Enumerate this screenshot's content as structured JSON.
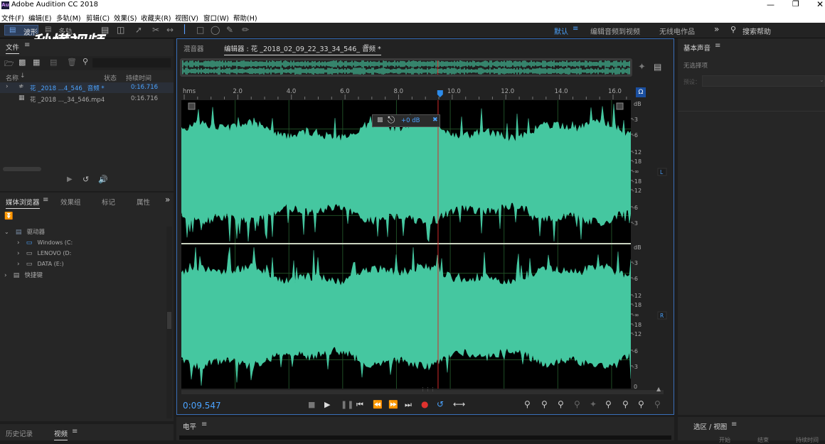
{
  "app": {
    "title": "Adobe Audition CC 2018",
    "logo": "Au"
  },
  "menu": [
    "文件(F)",
    "编辑(E)",
    "多轨(M)",
    "剪辑(C)",
    "效果(S)",
    "收藏夹(R)",
    "视图(V)",
    "窗口(W)",
    "帮助(H)"
  ],
  "toolbar": {
    "mode_waveform": "波形",
    "mode_multitrack": "多轨",
    "workspaces": [
      "默认",
      "编辑音频到视频",
      "无线电作品"
    ],
    "search_placeholder": "搜索帮助",
    "watermark": "秒懂视频"
  },
  "files_panel": {
    "tab": "文件",
    "columns": {
      "name": "名称",
      "status": "状态",
      "duration": "持续时间"
    },
    "rows": [
      {
        "name": "花 _2018 ...4_546_ 音频 *",
        "duration": "0:16.716",
        "selected": true
      },
      {
        "name": "花 _2018 ..._34_546.mp4",
        "duration": "0:16.716",
        "selected": false
      }
    ]
  },
  "media_panel": {
    "tabs": [
      "媒体浏览器",
      "效果组",
      "标记",
      "属性"
    ],
    "tree": [
      {
        "label": "驱动器",
        "level": 0
      },
      {
        "label": "Windows (C:",
        "level": 1
      },
      {
        "label": "LENOVO (D:",
        "level": 1
      },
      {
        "label": "DATA (E:)",
        "level": 1
      },
      {
        "label": "快捷键",
        "level": 0
      }
    ]
  },
  "bottom_left_tabs": [
    "历史记录",
    "视频"
  ],
  "editor": {
    "tab_mixer": "混音器",
    "tab_editor": "编辑器 : 花 _2018_02_09_22_33_34_546_ 音频 *",
    "time_unit": "hms",
    "ruler_ticks": [
      "2.0",
      "4.0",
      "6.0",
      "8.0",
      "10.0",
      "12.0",
      "14.0",
      "16.0"
    ],
    "playhead_time": "9.547",
    "duration": "16.716",
    "hud_gain": "+0 dB",
    "db_scale": [
      "dB",
      "-3",
      "-6",
      "-12",
      "-18",
      "-∞",
      "-18",
      "-12",
      "-6",
      "-3"
    ],
    "db_scale_bottom_zero": "0",
    "channels": [
      "L",
      "R"
    ],
    "current_time": "0:09.547"
  },
  "right_panel": {
    "title": "基本声音",
    "no_selection": "无选择项",
    "preset_label": "预设："
  },
  "levels_panel": {
    "title": "电平"
  },
  "selection_panel": {
    "title": "选区 / 视图",
    "columns": [
      "开始",
      "结束",
      "持续时间"
    ]
  },
  "colors": {
    "waveform": "#45c7a0",
    "accent": "#2d8ceb",
    "playhead": "#d22a2a",
    "background": "#1d1d1d"
  }
}
